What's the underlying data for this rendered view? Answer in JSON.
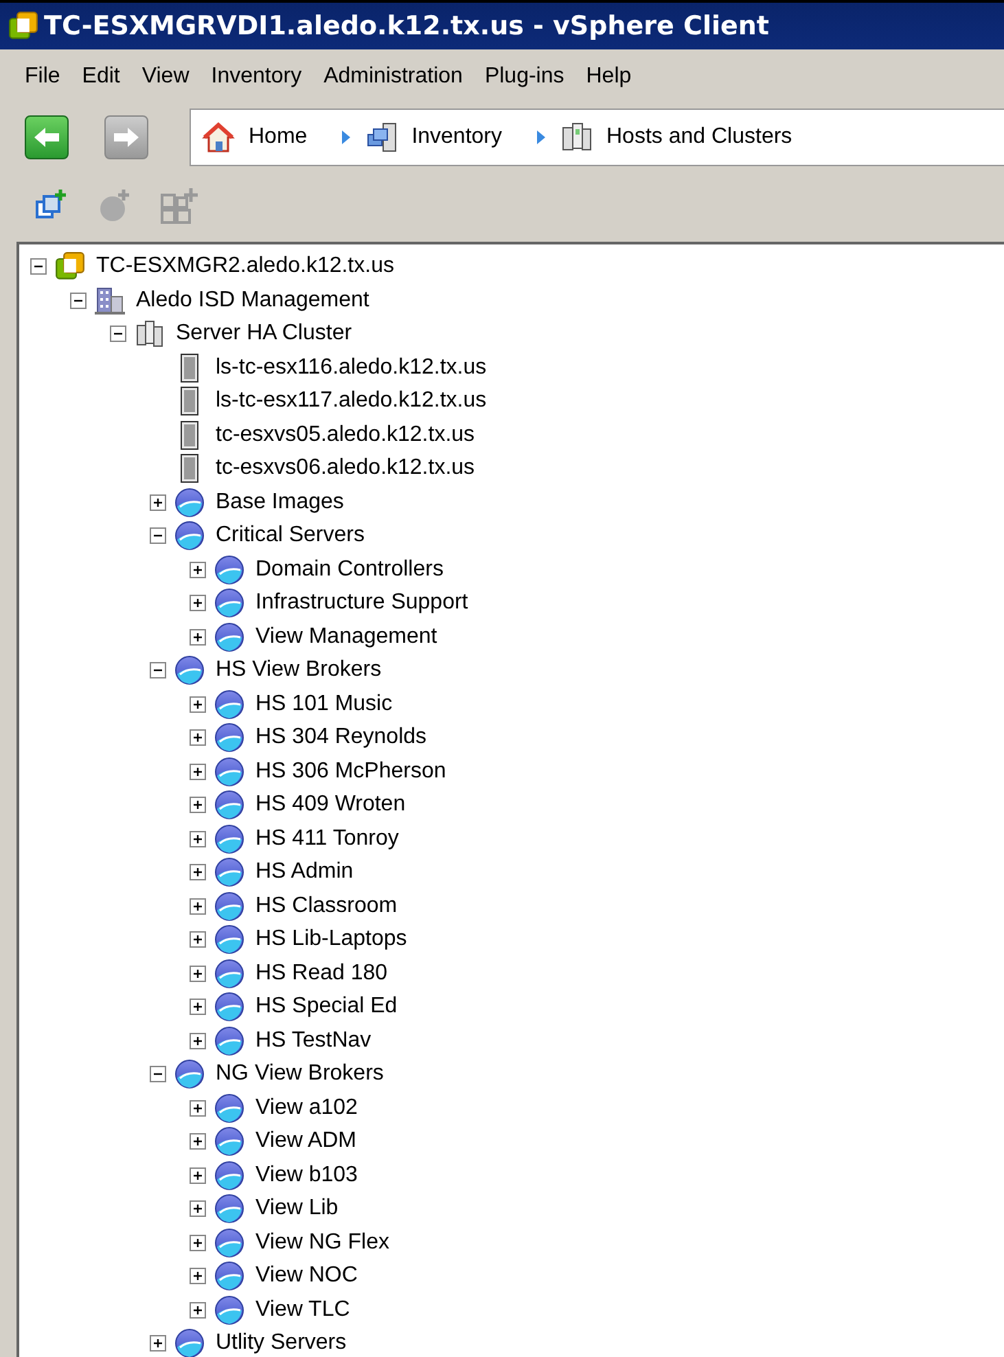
{
  "window": {
    "title": "TC-ESXMGRVDI1.aledo.k12.tx.us - vSphere Client"
  },
  "menu": [
    "File",
    "Edit",
    "View",
    "Inventory",
    "Administration",
    "Plug-ins",
    "Help"
  ],
  "navigation": {
    "back": {
      "disabled": false
    },
    "forward": {
      "disabled": true
    },
    "breadcrumbs": [
      {
        "label": "Home",
        "kind": "home"
      },
      {
        "label": "Inventory",
        "kind": "inventory"
      },
      {
        "label": "Hosts and Clusters",
        "kind": "hosts"
      }
    ]
  },
  "toolbar": [
    {
      "kind": "add-host",
      "disabled": false
    },
    {
      "kind": "add-pool",
      "disabled": true
    },
    {
      "kind": "add-cluster",
      "disabled": true
    }
  ],
  "tree": [
    {
      "label": "TC-ESXMGR2.aledo.k12.tx.us",
      "kind": "vcenter",
      "expanded": true,
      "children": [
        {
          "label": "Aledo ISD Management",
          "kind": "datacenter",
          "expanded": true,
          "children": [
            {
              "label": "Server HA Cluster",
              "kind": "cluster",
              "expanded": true,
              "children": [
                {
                  "label": "ls-tc-esx116.aledo.k12.tx.us",
                  "kind": "host"
                },
                {
                  "label": "ls-tc-esx117.aledo.k12.tx.us",
                  "kind": "host"
                },
                {
                  "label": "tc-esxvs05.aledo.k12.tx.us",
                  "kind": "host"
                },
                {
                  "label": "tc-esxvs06.aledo.k12.tx.us",
                  "kind": "host"
                },
                {
                  "label": "Base Images",
                  "kind": "pool",
                  "expanded": false
                },
                {
                  "label": "Critical Servers",
                  "kind": "pool",
                  "expanded": true,
                  "children": [
                    {
                      "label": "Domain Controllers",
                      "kind": "pool",
                      "expanded": false
                    },
                    {
                      "label": "Infrastructure Support",
                      "kind": "pool",
                      "expanded": false
                    },
                    {
                      "label": "View Management",
                      "kind": "pool",
                      "expanded": false
                    }
                  ]
                },
                {
                  "label": "HS View Brokers",
                  "kind": "pool",
                  "expanded": true,
                  "children": [
                    {
                      "label": "HS 101 Music",
                      "kind": "pool",
                      "expanded": false
                    },
                    {
                      "label": "HS 304 Reynolds",
                      "kind": "pool",
                      "expanded": false
                    },
                    {
                      "label": "HS 306 McPherson",
                      "kind": "pool",
                      "expanded": false
                    },
                    {
                      "label": "HS 409 Wroten",
                      "kind": "pool",
                      "expanded": false
                    },
                    {
                      "label": "HS 411 Tonroy",
                      "kind": "pool",
                      "expanded": false
                    },
                    {
                      "label": "HS Admin",
                      "kind": "pool",
                      "expanded": false
                    },
                    {
                      "label": "HS Classroom",
                      "kind": "pool",
                      "expanded": false
                    },
                    {
                      "label": "HS Lib-Laptops",
                      "kind": "pool",
                      "expanded": false
                    },
                    {
                      "label": "HS Read 180",
                      "kind": "pool",
                      "expanded": false
                    },
                    {
                      "label": "HS Special Ed",
                      "kind": "pool",
                      "expanded": false
                    },
                    {
                      "label": "HS TestNav",
                      "kind": "pool",
                      "expanded": false
                    }
                  ]
                },
                {
                  "label": "NG View Brokers",
                  "kind": "pool",
                  "expanded": true,
                  "children": [
                    {
                      "label": "View a102",
                      "kind": "pool",
                      "expanded": false
                    },
                    {
                      "label": "View ADM",
                      "kind": "pool",
                      "expanded": false
                    },
                    {
                      "label": "View b103",
                      "kind": "pool",
                      "expanded": false
                    },
                    {
                      "label": "View Lib",
                      "kind": "pool",
                      "expanded": false
                    },
                    {
                      "label": "View NG Flex",
                      "kind": "pool",
                      "expanded": false
                    },
                    {
                      "label": "View NOC",
                      "kind": "pool",
                      "expanded": false
                    },
                    {
                      "label": "View TLC",
                      "kind": "pool",
                      "expanded": false
                    }
                  ]
                },
                {
                  "label": "Utlity Servers",
                  "kind": "pool",
                  "expanded": false
                }
              ]
            }
          ]
        }
      ]
    }
  ]
}
